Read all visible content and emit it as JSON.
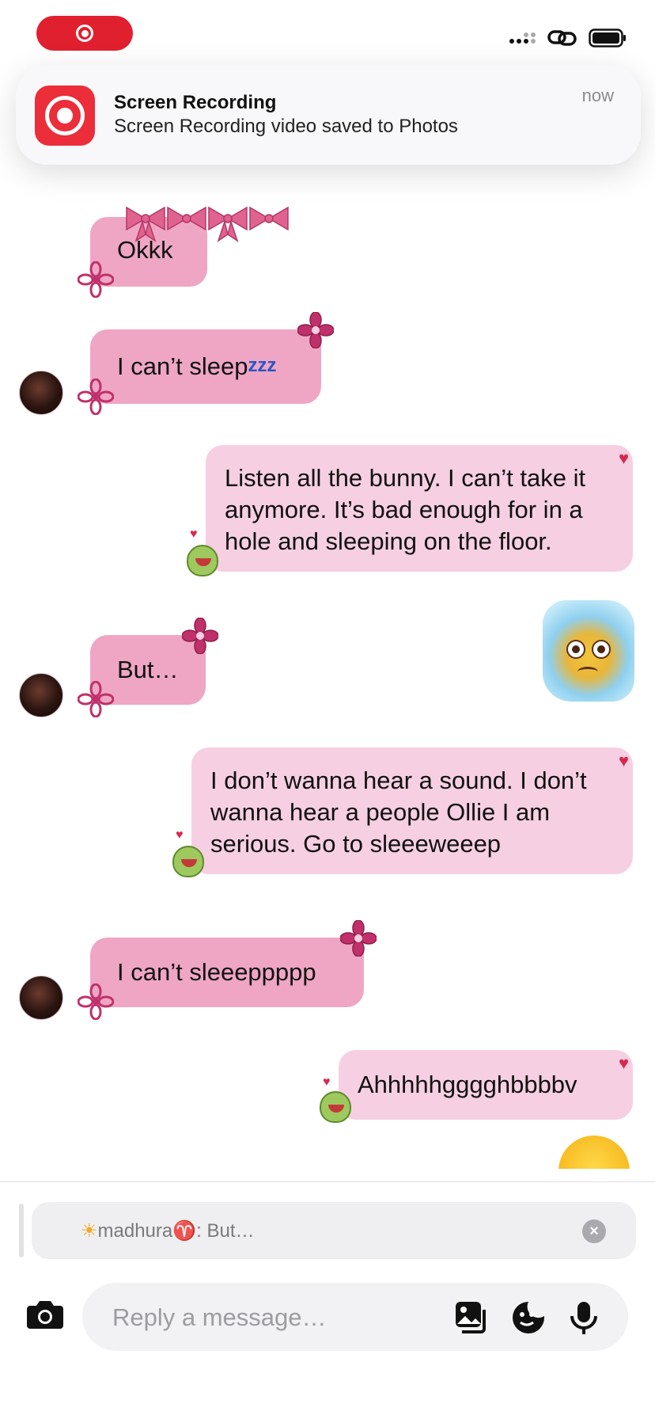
{
  "notification": {
    "title": "Screen Recording",
    "body": "Screen Recording video saved to Photos",
    "time": "now"
  },
  "messages": [
    {
      "from": "them",
      "text": "Okkk"
    },
    {
      "from": "them",
      "text": "I can’t sleep",
      "suffix": "zzz"
    },
    {
      "from": "me",
      "text": "Listen all the bunny. I can’t take it anymore. It’s bad enough for in a hole and sleeping on the floor."
    },
    {
      "from": "them",
      "text": "But…"
    },
    {
      "from": "me",
      "sticker": "crying-ice-cube-emoji"
    },
    {
      "from": "me",
      "text": "I don’t wanna hear a sound. I don’t wanna hear a people Ollie I am serious. Go to sleeeweeep"
    },
    {
      "from": "them",
      "text": "I can’t sleeeppppp"
    },
    {
      "from": "me",
      "text": "Ahhhhhgggghbbbbv"
    }
  ],
  "reply": {
    "name": "madhura",
    "separator": ":",
    "quote": "But…"
  },
  "composer": {
    "placeholder": "Reply a message…"
  },
  "colors": {
    "received_bubble": "#efa6c4",
    "sent_bubble": "#f6cfe2",
    "record_red": "#e0202f"
  }
}
